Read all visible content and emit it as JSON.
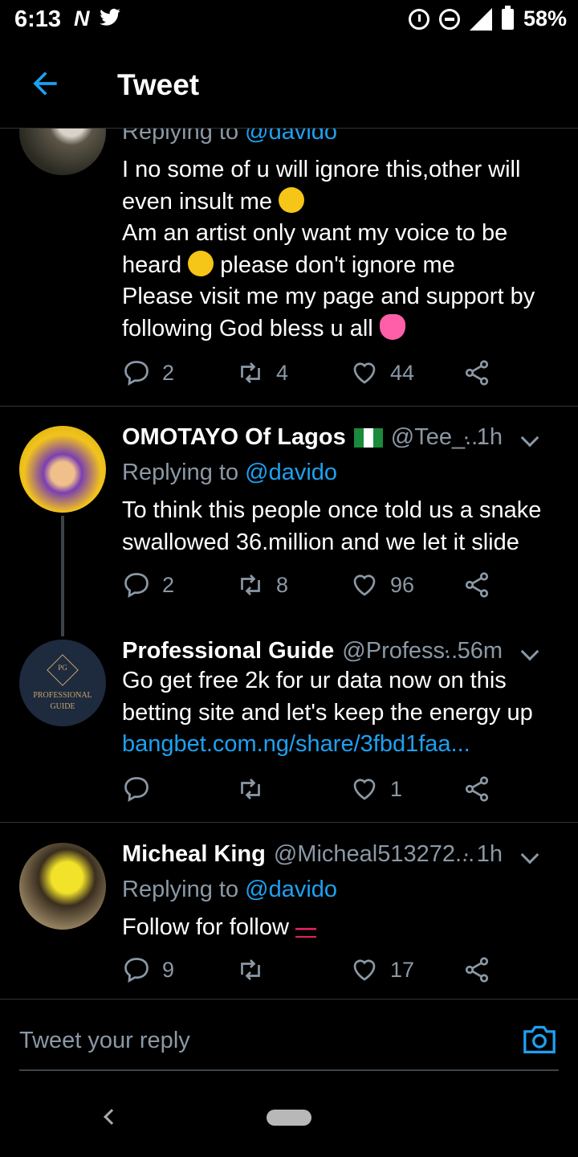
{
  "status_bar": {
    "time": "6:13",
    "left_icons": [
      "netflix-icon",
      "twitter-icon"
    ],
    "network": "3G",
    "battery": "58%"
  },
  "header": {
    "title": "Tweet",
    "back_icon": "arrow-left-icon"
  },
  "tweets": [
    {
      "reply_to_label": "Replying to",
      "reply_to": "@davido",
      "lines": [
        "I no some of u will ignore this,other will",
        "even insult me",
        "Am an artist only want my voice to be",
        "heard",
        "please don't ignore me",
        "Please visit me my page and support by",
        "following God bless u all"
      ],
      "replies": "2",
      "retweets": "4",
      "likes": "44"
    },
    {
      "name": "OMOTAYO Of Lagos",
      "handle": "@Tee_...",
      "time": "· 1h",
      "reply_to_label": "Replying to",
      "reply_to": "@davido",
      "lines": [
        "To think this people once told us a snake",
        "swallowed 36.million and we let it slide"
      ],
      "replies": "2",
      "retweets": "8",
      "likes": "96"
    },
    {
      "name": "Professional Guide",
      "handle": "@Profess...",
      "time": "· 56m",
      "avatar_text_1": "PROFESSIONAL",
      "avatar_text_2": "GUIDE",
      "avatar_logo": "PG",
      "lines": [
        "Go get free 2k for ur data now on this",
        "betting site and let's keep the energy up"
      ],
      "link": "bangbet.com.ng/share/3fbd1faa...",
      "replies": "",
      "retweets": "",
      "likes": "1"
    },
    {
      "name": "Micheal King",
      "handle": "@Micheal513272...",
      "time": "· 1h",
      "reply_to_label": "Replying to",
      "reply_to": "@davido",
      "lines": [
        "Follow for follow"
      ],
      "replies": "9",
      "retweets": "",
      "likes": "17"
    }
  ],
  "composer": {
    "placeholder": "Tweet your reply",
    "camera_icon": "camera-icon"
  },
  "colors": {
    "accent": "#1da1f2",
    "muted": "#8b98a5",
    "background": "#000000"
  }
}
